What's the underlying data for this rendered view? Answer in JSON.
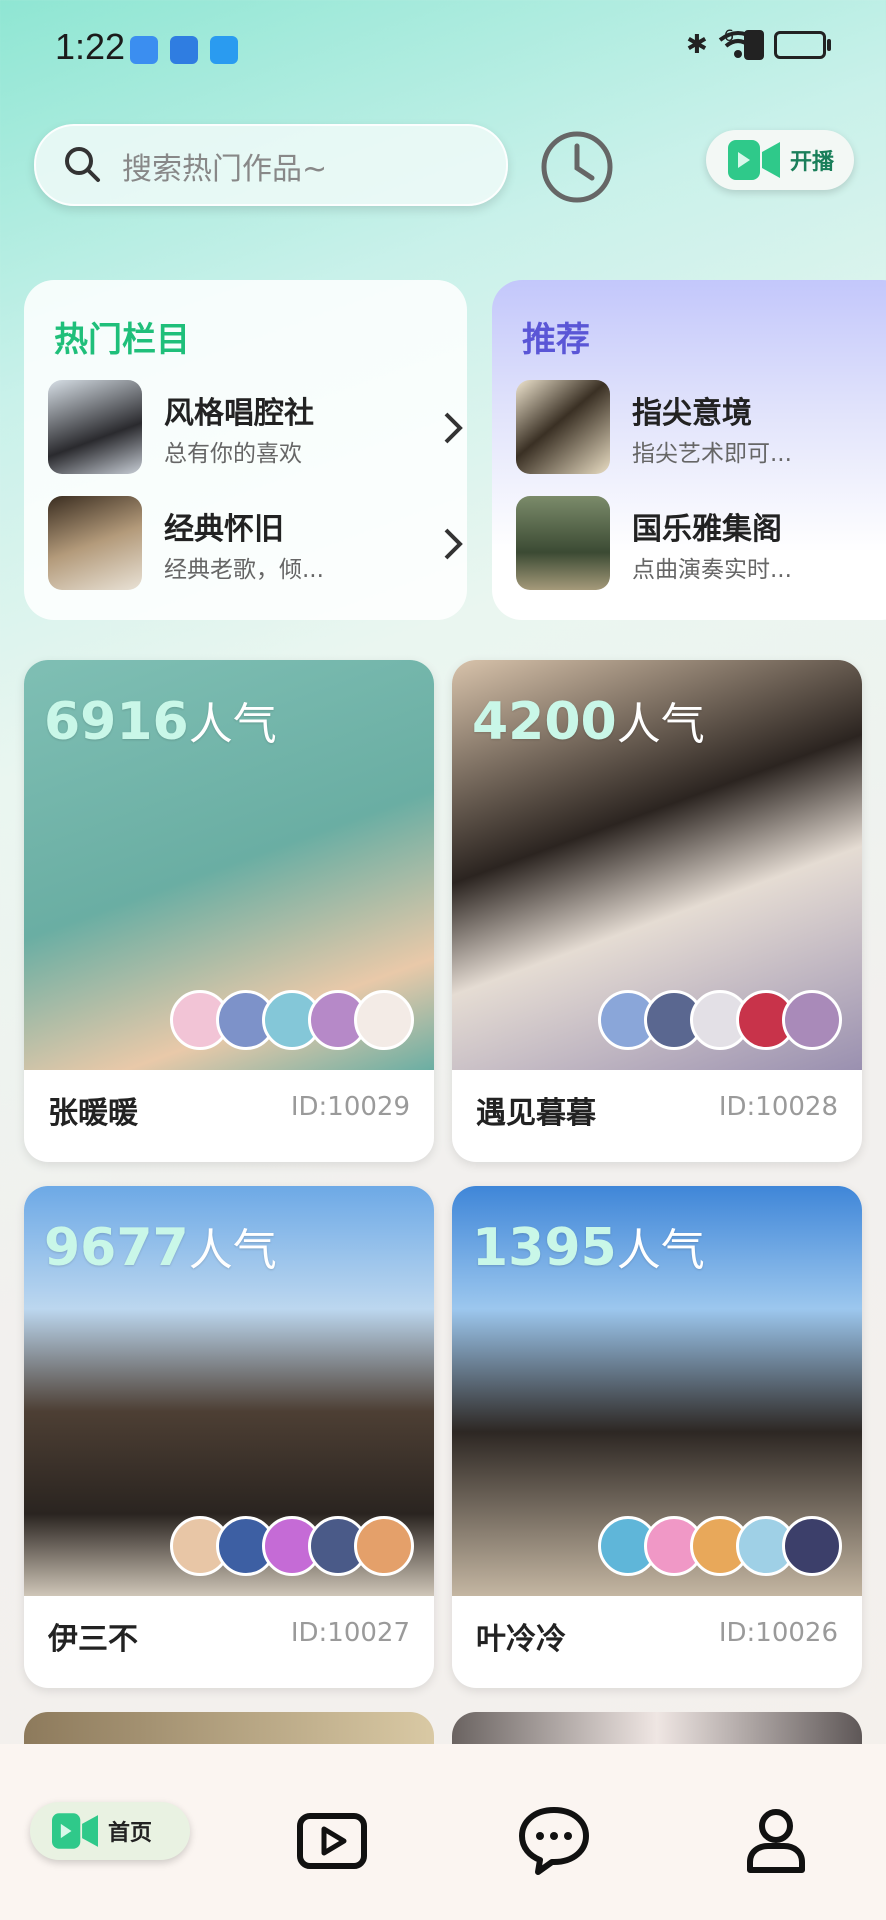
{
  "status_bar": {
    "time": "1:22",
    "signal": "6"
  },
  "header": {
    "search_placeholder": "搜索热门作品~",
    "live_label": "开播"
  },
  "hot_panel": {
    "title": "热门栏目",
    "items": [
      {
        "title": "风格唱腔社",
        "subtitle": "总有你的喜欢"
      },
      {
        "title": "经典怀旧",
        "subtitle": "经典老歌，倾..."
      }
    ]
  },
  "rec_panel": {
    "title": "推荐",
    "items": [
      {
        "title": "指尖意境",
        "subtitle": "指尖艺术即可..."
      },
      {
        "title": "国乐雅集阁",
        "subtitle": "点曲演奏实时..."
      }
    ]
  },
  "cards": [
    {
      "popularity": "6916",
      "unit": "人气",
      "name": "张暖暖",
      "id": "ID:10029"
    },
    {
      "popularity": "4200",
      "unit": "人气",
      "name": "遇见暮暮",
      "id": "ID:10028"
    },
    {
      "popularity": "9677",
      "unit": "人气",
      "name": "伊三不",
      "id": "ID:10027"
    },
    {
      "popularity": "1395",
      "unit": "人气",
      "name": "叶冷冷",
      "id": "ID:10026"
    }
  ],
  "nav": {
    "home_label": "首页"
  },
  "colors": {
    "accent_green": "#1fbf7a",
    "rec_purple": "#5a56d6"
  }
}
